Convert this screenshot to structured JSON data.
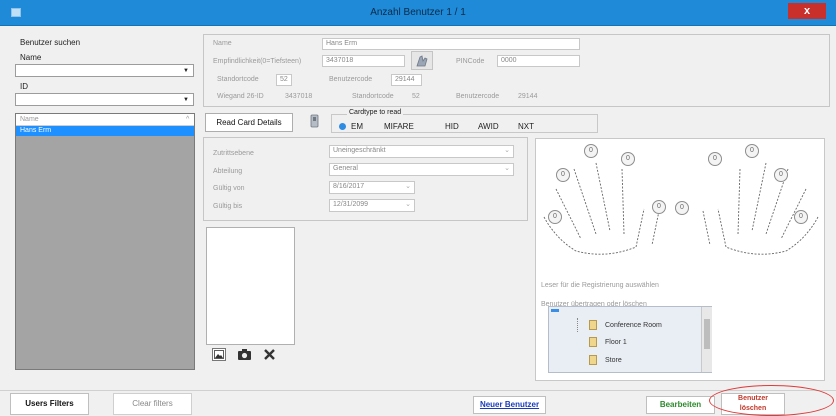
{
  "window": {
    "title": "Anzahl Benutzer 1 / 1",
    "close_label": "x"
  },
  "search": {
    "heading": "Benutzer suchen",
    "name_label": "Name",
    "id_label": "ID"
  },
  "userlist": {
    "header": "Name",
    "sort_glyph": "^",
    "items": [
      "Hans Erm"
    ]
  },
  "details": {
    "name_label": "Name",
    "name_value": "Hans Erm",
    "sensitivity_label": "Empfindlichkeit(0=Tiefsteen)",
    "sensitivity_value": "3437018",
    "pin_label": "PINCode",
    "pin_value": "0000",
    "sitecode_label": "Standortcode",
    "sitecode_value": "52",
    "usercode_label": "Benutzercode",
    "usercode_value": "29144",
    "wiegand_label": "Wiegand 26-ID",
    "wiegand_value": "3437018",
    "site2_label": "Standortcode",
    "site2_value": "52",
    "user2_label": "Benutzercode",
    "user2_value": "29144"
  },
  "cardread": {
    "button": "Read Card Details",
    "group_title": "Cardtype to read",
    "types": [
      "EM",
      "MIFARE",
      "HID",
      "AWID",
      "NXT"
    ],
    "selected": "EM"
  },
  "access": {
    "level_label": "Zutrittsebene",
    "level_value": "Uneingeschränkt",
    "dept_label": "Abteilung",
    "dept_value": "General",
    "valid_from_label": "Gültig von",
    "valid_from_value": "8/16/2017",
    "valid_to_label": "Gültig bis",
    "valid_to_value": "12/31/2099"
  },
  "hands": {
    "left_fingers": [
      "0",
      "0",
      "0",
      "0",
      "0"
    ],
    "right_fingers": [
      "0",
      "0",
      "0",
      "0",
      "0"
    ],
    "reader_label": "Leser für die Registrierung auswählen",
    "transfer_label": "Benutzer übertragen oder löschen",
    "tree": [
      "Conference Room",
      "Floor 1",
      "Store"
    ]
  },
  "footer": {
    "users_filters": "Users Filters",
    "clear_filters": "Clear filters",
    "new_user": "Neuer Benutzer",
    "edit": "Bearbeiten",
    "delete": "Benutzer löschen"
  },
  "colors": {
    "accent": "#1e8ad8",
    "selection": "#1e90ff",
    "delete_text": "#c0392b",
    "new_user_text": "#1a3cb8",
    "edit_text": "#2a8a2a"
  }
}
